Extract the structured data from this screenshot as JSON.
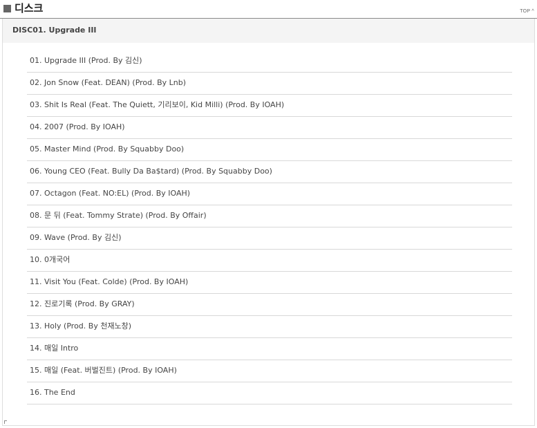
{
  "header": {
    "title": "디스크",
    "top_link": "TOP",
    "top_caret": "^"
  },
  "disc": {
    "title": "DISC01. Upgrade III"
  },
  "tracks": [
    "01. Upgrade III (Prod. By 김신)",
    "02. Jon Snow (Feat. DEAN) (Prod. By Lnb)",
    "03. Shit Is Real (Feat. The Quiett, 기리보이, Kid Milli) (Prod. By IOAH)",
    "04. 2007 (Prod. By IOAH)",
    "05. Master Mind (Prod. By Squabby Doo)",
    "06. Young CEO (Feat. Bully Da Ba$tard) (Prod. By Squabby Doo)",
    "07. Octagon (Feat. NO:EL) (Prod. By IOAH)",
    "08. 문 뒤 (Feat. Tommy Strate) (Prod. By Offair)",
    "09. Wave (Prod. By 김신)",
    "10. 0개국어",
    "11. Visit You (Feat. Colde) (Prod. By IOAH)",
    "12. 진로기록 (Prod. By GRAY)",
    "13. Holy (Prod. By 천재노창)",
    "14. 매일 Intro",
    "15. 매일 (Feat. 버벌진트) (Prod. By IOAH)",
    "16. The End"
  ]
}
